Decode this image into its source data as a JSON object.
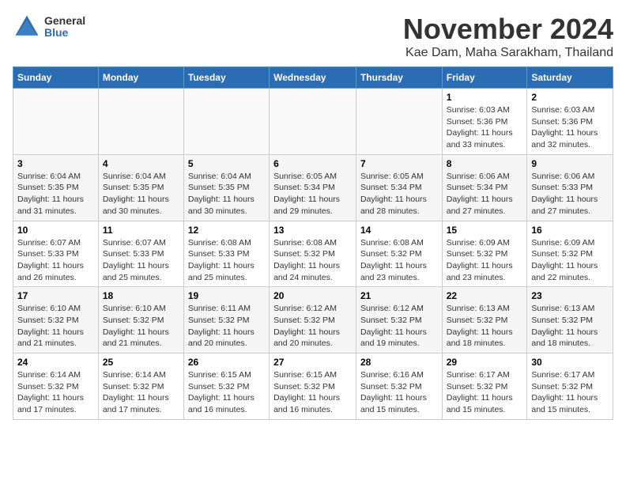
{
  "header": {
    "logo_general": "General",
    "logo_blue": "Blue",
    "title": "November 2024",
    "location": "Kae Dam, Maha Sarakham, Thailand"
  },
  "days_of_week": [
    "Sunday",
    "Monday",
    "Tuesday",
    "Wednesday",
    "Thursday",
    "Friday",
    "Saturday"
  ],
  "weeks": [
    [
      {
        "day": "",
        "info": ""
      },
      {
        "day": "",
        "info": ""
      },
      {
        "day": "",
        "info": ""
      },
      {
        "day": "",
        "info": ""
      },
      {
        "day": "",
        "info": ""
      },
      {
        "day": "1",
        "info": "Sunrise: 6:03 AM\nSunset: 5:36 PM\nDaylight: 11 hours\nand 33 minutes."
      },
      {
        "day": "2",
        "info": "Sunrise: 6:03 AM\nSunset: 5:36 PM\nDaylight: 11 hours\nand 32 minutes."
      }
    ],
    [
      {
        "day": "3",
        "info": "Sunrise: 6:04 AM\nSunset: 5:35 PM\nDaylight: 11 hours\nand 31 minutes."
      },
      {
        "day": "4",
        "info": "Sunrise: 6:04 AM\nSunset: 5:35 PM\nDaylight: 11 hours\nand 30 minutes."
      },
      {
        "day": "5",
        "info": "Sunrise: 6:04 AM\nSunset: 5:35 PM\nDaylight: 11 hours\nand 30 minutes."
      },
      {
        "day": "6",
        "info": "Sunrise: 6:05 AM\nSunset: 5:34 PM\nDaylight: 11 hours\nand 29 minutes."
      },
      {
        "day": "7",
        "info": "Sunrise: 6:05 AM\nSunset: 5:34 PM\nDaylight: 11 hours\nand 28 minutes."
      },
      {
        "day": "8",
        "info": "Sunrise: 6:06 AM\nSunset: 5:34 PM\nDaylight: 11 hours\nand 27 minutes."
      },
      {
        "day": "9",
        "info": "Sunrise: 6:06 AM\nSunset: 5:33 PM\nDaylight: 11 hours\nand 27 minutes."
      }
    ],
    [
      {
        "day": "10",
        "info": "Sunrise: 6:07 AM\nSunset: 5:33 PM\nDaylight: 11 hours\nand 26 minutes."
      },
      {
        "day": "11",
        "info": "Sunrise: 6:07 AM\nSunset: 5:33 PM\nDaylight: 11 hours\nand 25 minutes."
      },
      {
        "day": "12",
        "info": "Sunrise: 6:08 AM\nSunset: 5:33 PM\nDaylight: 11 hours\nand 25 minutes."
      },
      {
        "day": "13",
        "info": "Sunrise: 6:08 AM\nSunset: 5:32 PM\nDaylight: 11 hours\nand 24 minutes."
      },
      {
        "day": "14",
        "info": "Sunrise: 6:08 AM\nSunset: 5:32 PM\nDaylight: 11 hours\nand 23 minutes."
      },
      {
        "day": "15",
        "info": "Sunrise: 6:09 AM\nSunset: 5:32 PM\nDaylight: 11 hours\nand 23 minutes."
      },
      {
        "day": "16",
        "info": "Sunrise: 6:09 AM\nSunset: 5:32 PM\nDaylight: 11 hours\nand 22 minutes."
      }
    ],
    [
      {
        "day": "17",
        "info": "Sunrise: 6:10 AM\nSunset: 5:32 PM\nDaylight: 11 hours\nand 21 minutes."
      },
      {
        "day": "18",
        "info": "Sunrise: 6:10 AM\nSunset: 5:32 PM\nDaylight: 11 hours\nand 21 minutes."
      },
      {
        "day": "19",
        "info": "Sunrise: 6:11 AM\nSunset: 5:32 PM\nDaylight: 11 hours\nand 20 minutes."
      },
      {
        "day": "20",
        "info": "Sunrise: 6:12 AM\nSunset: 5:32 PM\nDaylight: 11 hours\nand 20 minutes."
      },
      {
        "day": "21",
        "info": "Sunrise: 6:12 AM\nSunset: 5:32 PM\nDaylight: 11 hours\nand 19 minutes."
      },
      {
        "day": "22",
        "info": "Sunrise: 6:13 AM\nSunset: 5:32 PM\nDaylight: 11 hours\nand 18 minutes."
      },
      {
        "day": "23",
        "info": "Sunrise: 6:13 AM\nSunset: 5:32 PM\nDaylight: 11 hours\nand 18 minutes."
      }
    ],
    [
      {
        "day": "24",
        "info": "Sunrise: 6:14 AM\nSunset: 5:32 PM\nDaylight: 11 hours\nand 17 minutes."
      },
      {
        "day": "25",
        "info": "Sunrise: 6:14 AM\nSunset: 5:32 PM\nDaylight: 11 hours\nand 17 minutes."
      },
      {
        "day": "26",
        "info": "Sunrise: 6:15 AM\nSunset: 5:32 PM\nDaylight: 11 hours\nand 16 minutes."
      },
      {
        "day": "27",
        "info": "Sunrise: 6:15 AM\nSunset: 5:32 PM\nDaylight: 11 hours\nand 16 minutes."
      },
      {
        "day": "28",
        "info": "Sunrise: 6:16 AM\nSunset: 5:32 PM\nDaylight: 11 hours\nand 15 minutes."
      },
      {
        "day": "29",
        "info": "Sunrise: 6:17 AM\nSunset: 5:32 PM\nDaylight: 11 hours\nand 15 minutes."
      },
      {
        "day": "30",
        "info": "Sunrise: 6:17 AM\nSunset: 5:32 PM\nDaylight: 11 hours\nand 15 minutes."
      }
    ]
  ]
}
